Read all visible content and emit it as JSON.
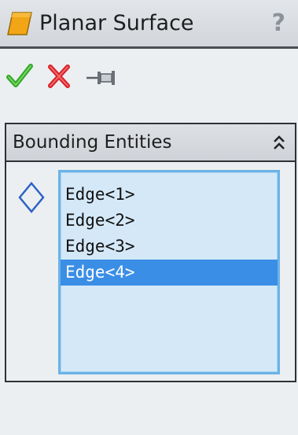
{
  "window": {
    "title": "Planar Surface",
    "help_label": "?",
    "icon": "planar-surface-icon"
  },
  "actions": [
    {
      "name": "ok",
      "icon": "checkmark-icon",
      "color": "#2fa82b"
    },
    {
      "name": "cancel",
      "icon": "x-icon",
      "color": "#d8222a"
    },
    {
      "name": "pin",
      "icon": "pushpin-icon",
      "color": "#5a5f66"
    }
  ],
  "group": {
    "title": "Bounding Entities",
    "collapse_icon": "double-chevron-up-icon",
    "entity_icon": "diamond-outline-icon",
    "items": [
      {
        "label": "Edge<1>",
        "selected": false
      },
      {
        "label": "Edge<2>",
        "selected": false
      },
      {
        "label": "Edge<3>",
        "selected": false
      },
      {
        "label": "Edge<4>",
        "selected": true
      }
    ]
  },
  "colors": {
    "list_background": "#d4e8f8",
    "list_border": "#6bb3e6",
    "selection": "#3a8ee6"
  }
}
